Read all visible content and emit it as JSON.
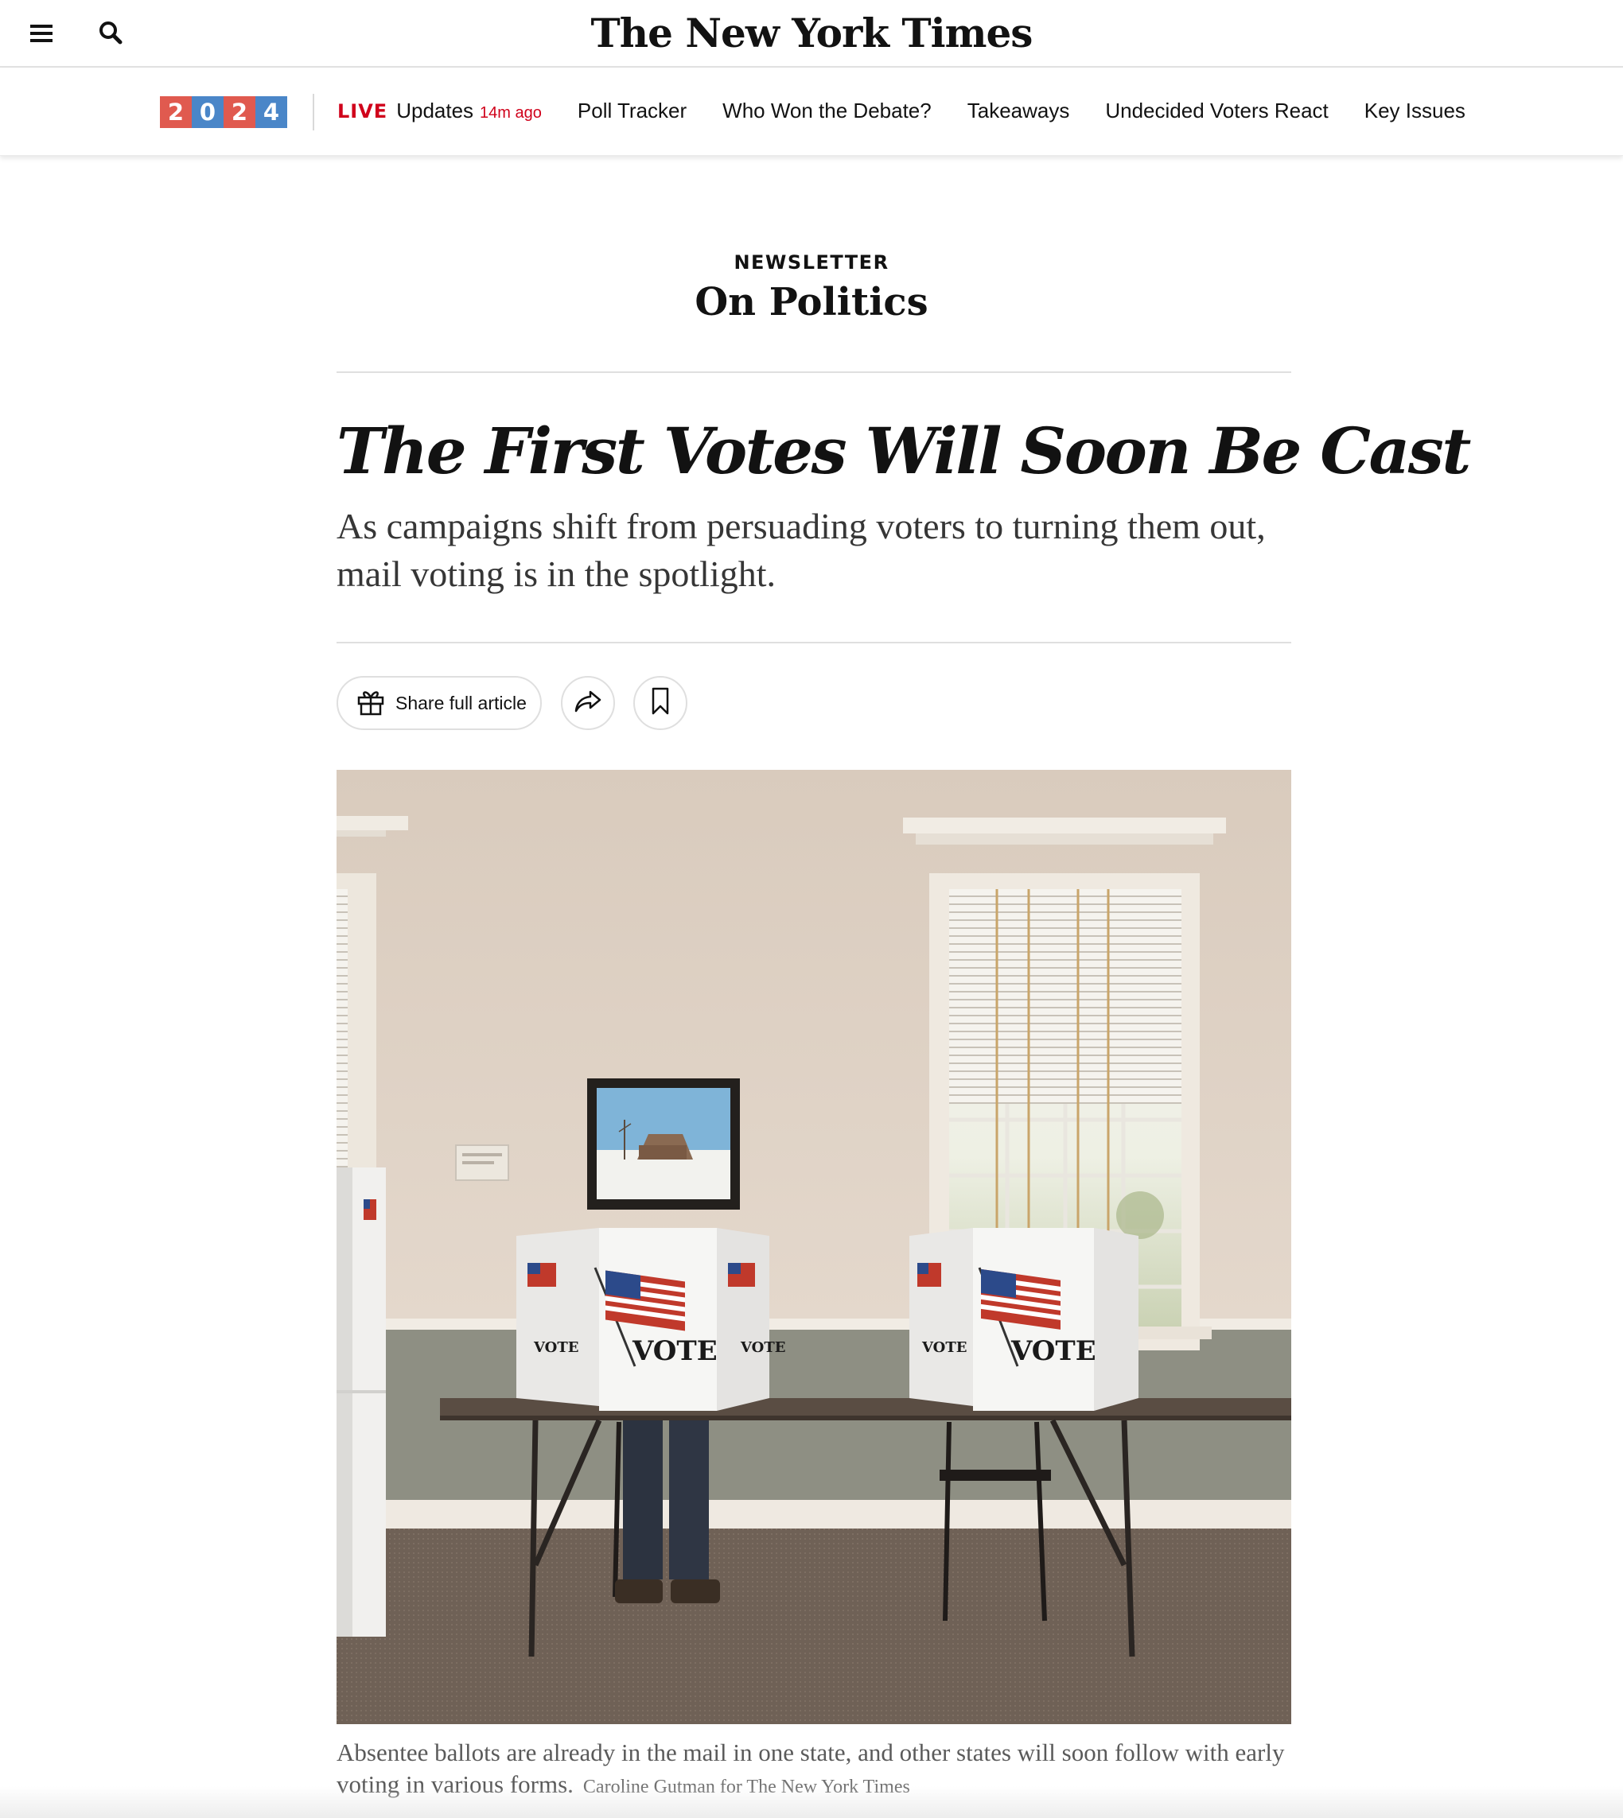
{
  "masthead": {
    "logo": "The New York Times",
    "menu_icon": "hamburger-menu-icon",
    "search_icon": "search-icon"
  },
  "election_nav": {
    "year_digits": [
      "2",
      "0",
      "2",
      "4"
    ],
    "digit_colors": [
      "#e05a4f",
      "#4a86c8",
      "#e05a4f",
      "#4a86c8"
    ],
    "live_label": "LIVE",
    "live_text": "Updates",
    "live_ago": "14m ago",
    "items": [
      "Poll Tracker",
      "Who Won the Debate?",
      "Takeaways",
      "Undecided Voters React",
      "Key Issues"
    ]
  },
  "article": {
    "kicker": "NEWSLETTER",
    "section": "On Politics",
    "headline": "The First Votes Will Soon Be Cast",
    "summary": "As campaigns shift from persuading voters to turning them out, mail voting is in the spotlight.",
    "share_label": "Share full article",
    "share_icon": "gift-icon",
    "forward_icon": "share-arrow-icon",
    "bookmark_icon": "bookmark-icon"
  },
  "photo": {
    "booth_text": "VOTE",
    "caption": "Absentee ballots are already in the mail in one state, and other states will soon follow with early voting in various forms.",
    "credit": "Caroline Gutman for The New York Times"
  },
  "colors": {
    "live_red": "#d0021b",
    "text": "#121212",
    "rule": "#dfdfdf"
  }
}
